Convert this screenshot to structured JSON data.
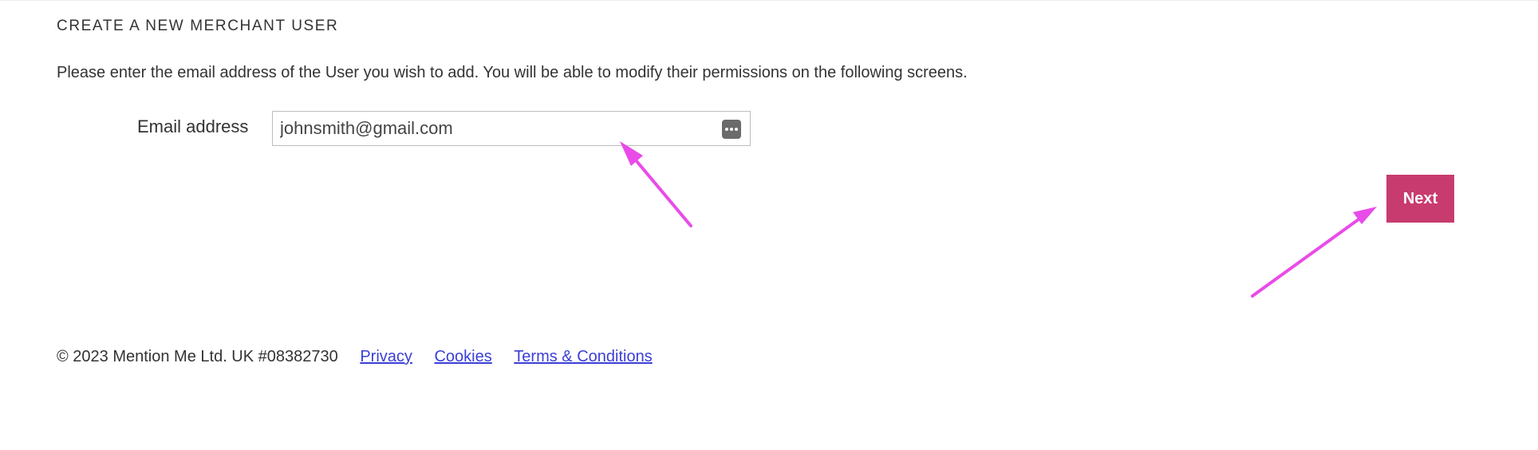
{
  "page": {
    "title": "CREATE A NEW MERCHANT USER",
    "intro": "Please enter the email address of the User you wish to add. You will be able to modify their permissions on the following screens."
  },
  "form": {
    "email_label": "Email address",
    "email_value": "johnsmith@gmail.com",
    "password_manager_icon": "password-manager-dots-icon"
  },
  "actions": {
    "next_label": "Next"
  },
  "footer": {
    "copyright": "© 2023 Mention Me Ltd. UK #08382730",
    "links": [
      "Privacy",
      "Cookies",
      "Terms & Conditions"
    ]
  },
  "colors": {
    "accent": "#c83b6e",
    "link": "#3b3fd6",
    "annotation_arrow": "#e94be8"
  }
}
